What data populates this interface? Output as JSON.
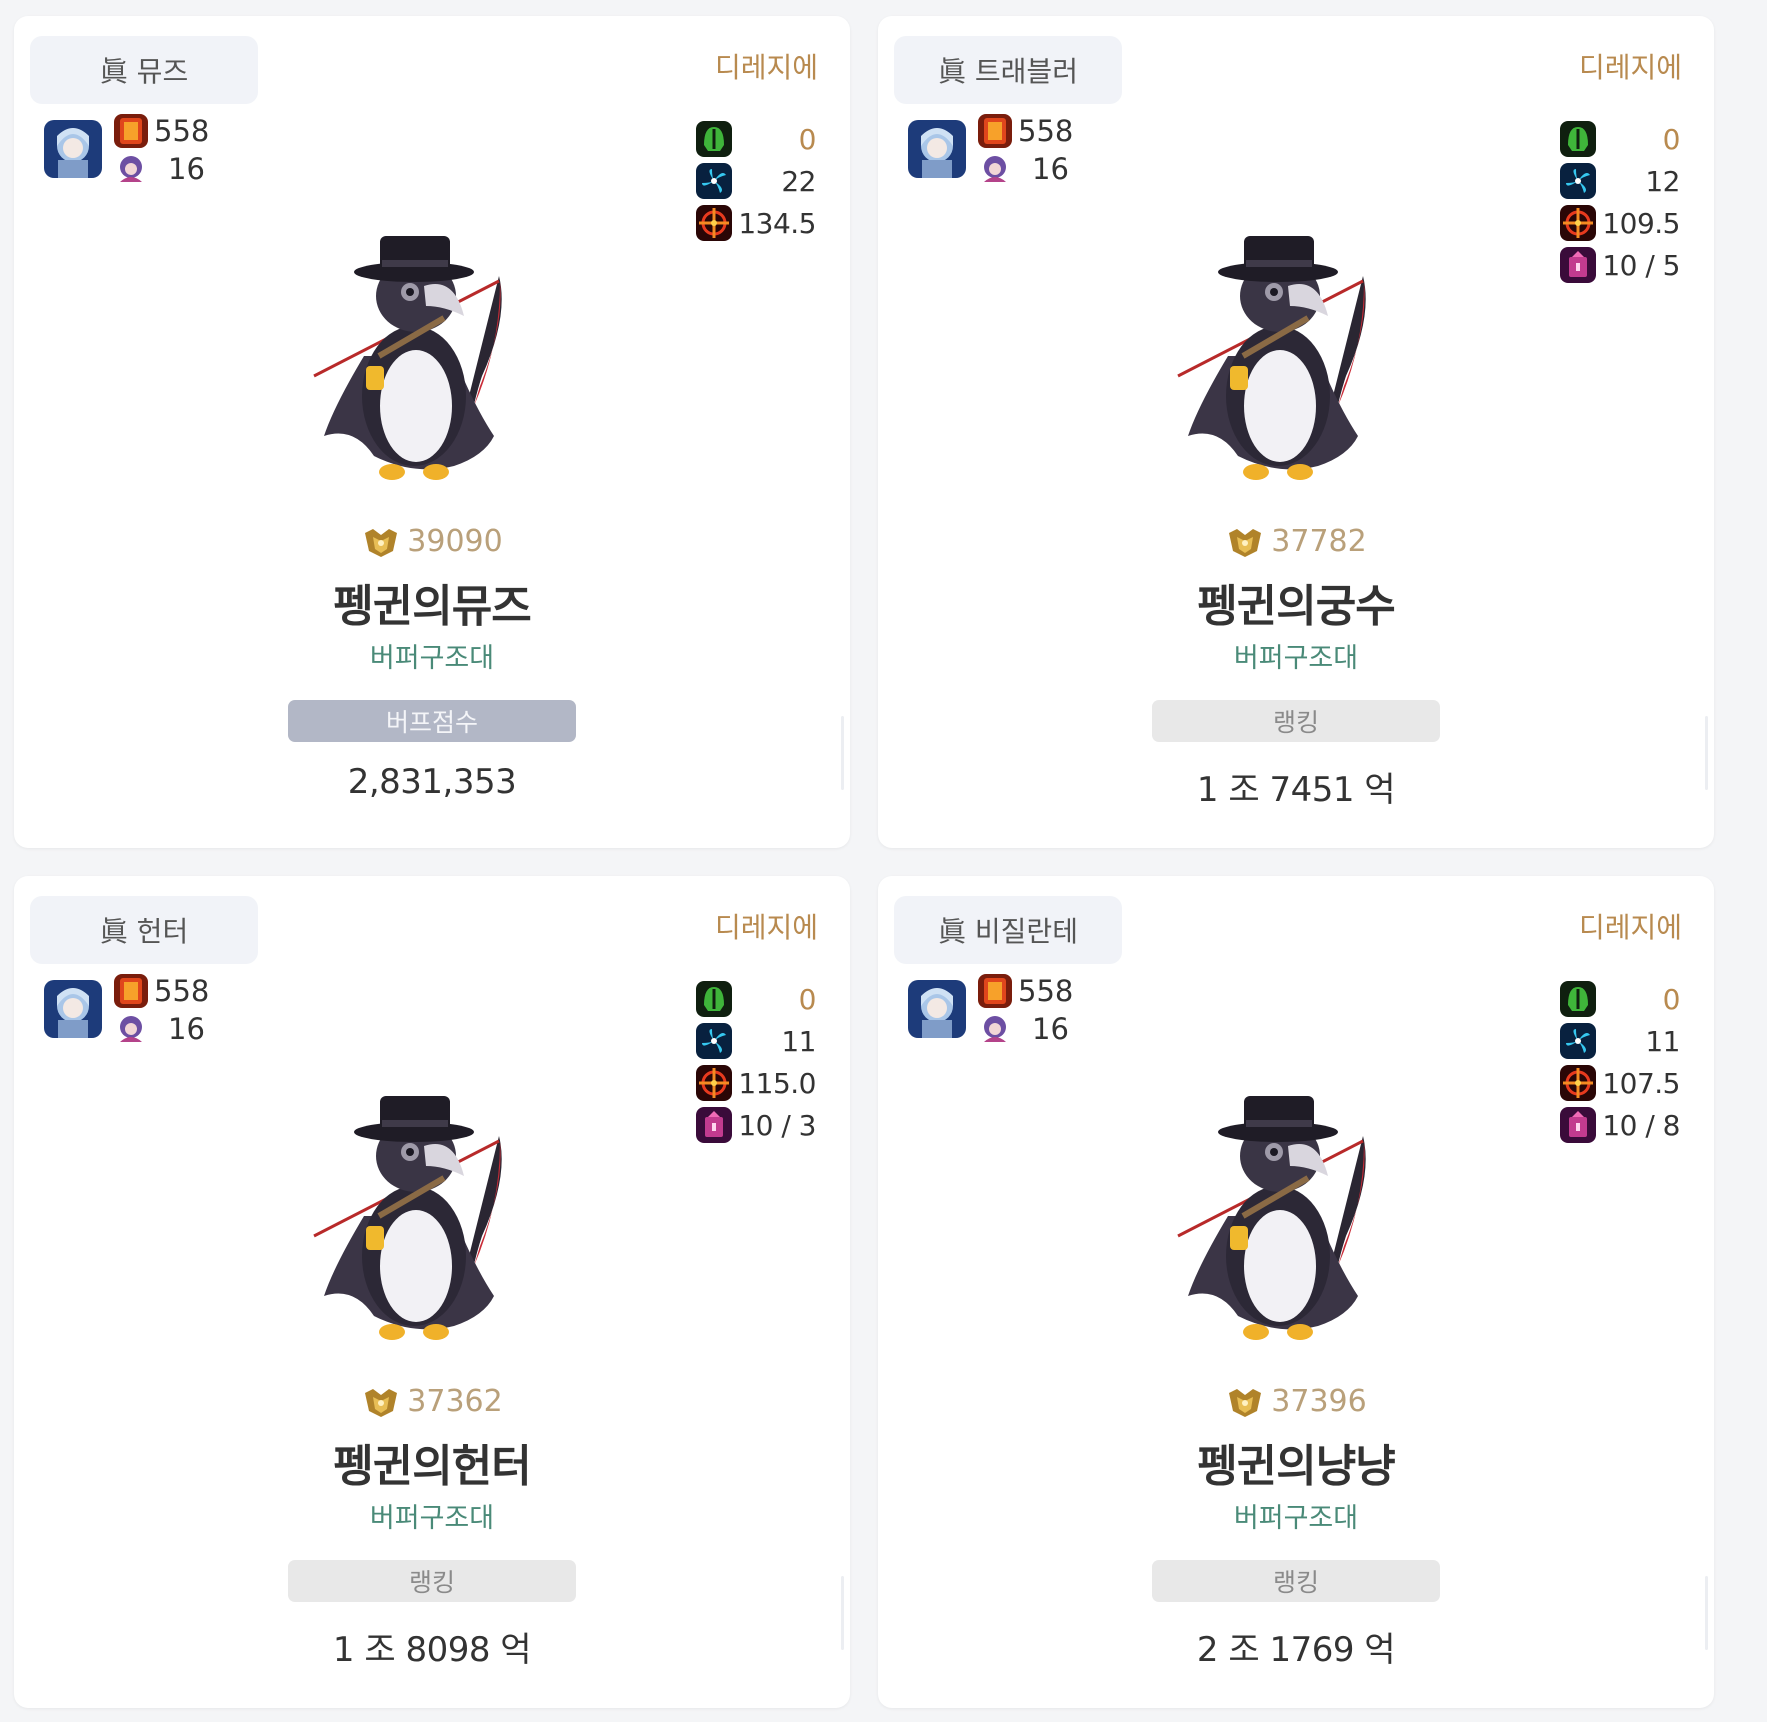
{
  "cards": [
    {
      "job": "眞 뮤즈",
      "server": "디레지에",
      "set_point": "558",
      "creature_level": "16",
      "stats": [
        {
          "icon": "green-helmet-icon",
          "value": "0"
        },
        {
          "icon": "blue-swirl-icon",
          "value": "22"
        },
        {
          "icon": "red-crosshair-icon",
          "value": "134.5"
        }
      ],
      "fame": "39090",
      "name": "펭귄의뮤즈",
      "guild": "버퍼구조대",
      "score_label": "버프점수",
      "score_style": "buff",
      "score_value": "2,831,353"
    },
    {
      "job": "眞 트래블러",
      "server": "디레지에",
      "set_point": "558",
      "creature_level": "16",
      "stats": [
        {
          "icon": "green-helmet-icon",
          "value": "0"
        },
        {
          "icon": "blue-swirl-icon",
          "value": "12"
        },
        {
          "icon": "red-crosshair-icon",
          "value": "109.5"
        },
        {
          "icon": "purple-box-icon",
          "value": "10 / 5"
        }
      ],
      "fame": "37782",
      "name": "펭귄의궁수",
      "guild": "버퍼구조대",
      "score_label": "랭킹",
      "score_style": "rank",
      "score_value": "1 조 7451 억"
    },
    {
      "job": "眞 헌터",
      "server": "디레지에",
      "set_point": "558",
      "creature_level": "16",
      "stats": [
        {
          "icon": "green-helmet-icon",
          "value": "0"
        },
        {
          "icon": "blue-swirl-icon",
          "value": "11"
        },
        {
          "icon": "red-crosshair-icon",
          "value": "115.0"
        },
        {
          "icon": "purple-box-icon",
          "value": "10 / 3"
        }
      ],
      "fame": "37362",
      "name": "펭귄의헌터",
      "guild": "버퍼구조대",
      "score_label": "랭킹",
      "score_style": "rank",
      "score_value": "1 조 8098 억"
    },
    {
      "job": "眞 비질란테",
      "server": "디레지에",
      "set_point": "558",
      "creature_level": "16",
      "stats": [
        {
          "icon": "green-helmet-icon",
          "value": "0"
        },
        {
          "icon": "blue-swirl-icon",
          "value": "11"
        },
        {
          "icon": "red-crosshair-icon",
          "value": "107.5"
        },
        {
          "icon": "purple-box-icon",
          "value": "10 / 8"
        }
      ],
      "fame": "37396",
      "name": "펭귄의냥냥",
      "guild": "버퍼구조대",
      "score_label": "랭킹",
      "score_style": "rank",
      "score_value": "2 조 1769 억"
    }
  ],
  "colors": {
    "server": "#b88a4f",
    "guild": "#4a8a78",
    "fame": "#b9a07a",
    "buff_label_bg": "#b2b7c6",
    "rank_label_bg": "#e8e8e8"
  }
}
